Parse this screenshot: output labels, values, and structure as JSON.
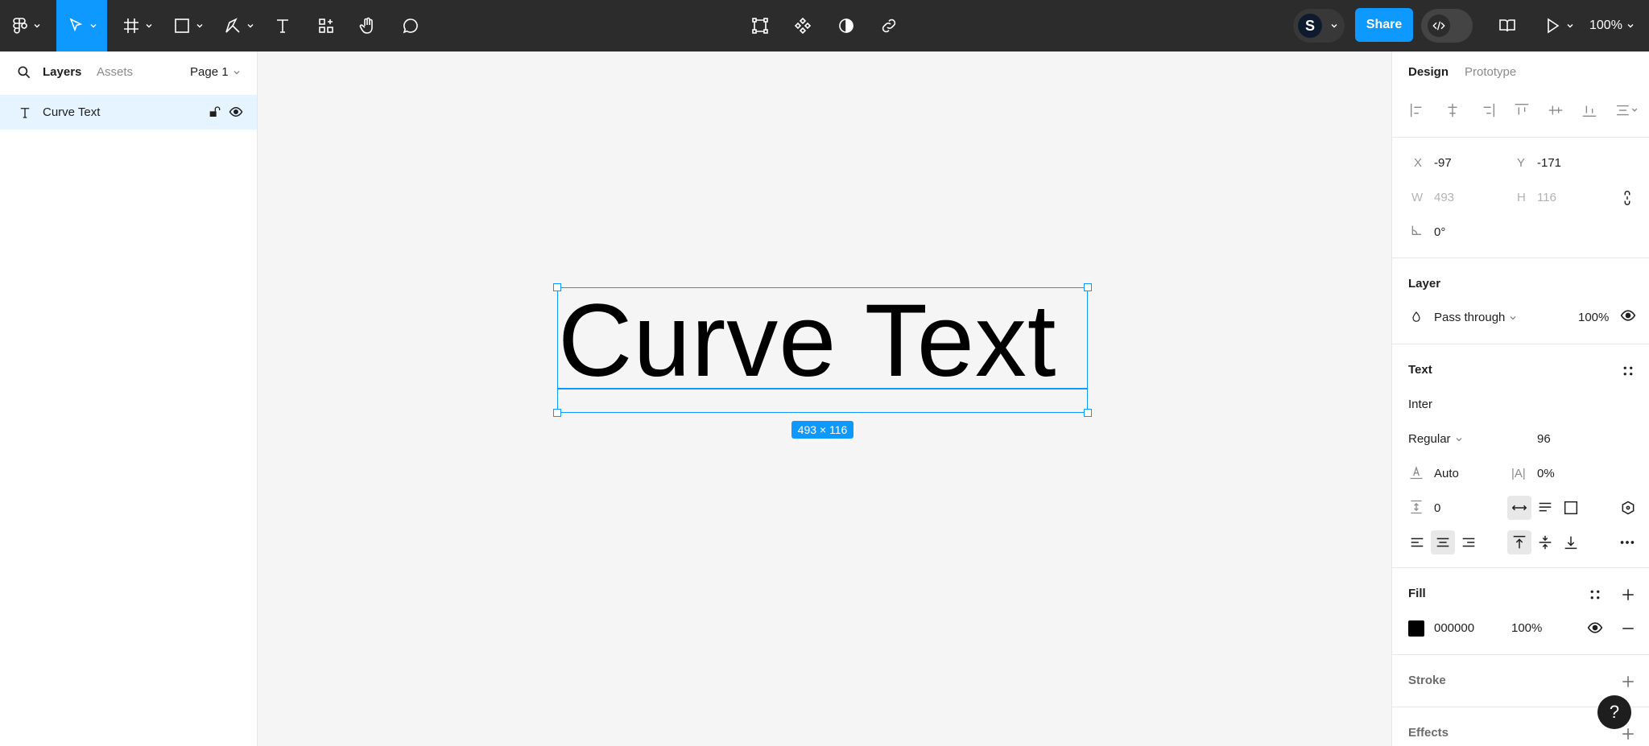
{
  "toolbar": {
    "share_label": "Share",
    "avatar_initial": "S",
    "zoom_label": "100%"
  },
  "left_panel": {
    "tabs": [
      "Layers",
      "Assets"
    ],
    "page_label": "Page 1",
    "layers": [
      {
        "name": "Curve Text",
        "type": "text"
      }
    ]
  },
  "canvas": {
    "text_content": "Curve Text",
    "dimension_badge": "493 × 116"
  },
  "right_panel": {
    "tabs": [
      "Design",
      "Prototype"
    ],
    "position": {
      "x_label": "X",
      "x_value": "-97",
      "y_label": "Y",
      "y_value": "-171",
      "w_label": "W",
      "w_value": "493",
      "h_label": "H",
      "h_value": "116",
      "rotation": "0°"
    },
    "layer": {
      "title": "Layer",
      "blend_mode": "Pass through",
      "opacity": "100%"
    },
    "text": {
      "title": "Text",
      "font_family": "Inter",
      "font_weight": "Regular",
      "font_size": "96",
      "line_height": "Auto",
      "letter_spacing": "0%",
      "paragraph_spacing": "0",
      "letter_spacing_icon": "|A|"
    },
    "fill": {
      "title": "Fill",
      "color_hex": "000000",
      "opacity": "100%",
      "swatch": "#000000"
    },
    "stroke": {
      "title": "Stroke"
    },
    "effects": {
      "title": "Effects"
    }
  },
  "colors": {
    "accent": "#0d99ff",
    "toolbar_bg": "#2c2c2c",
    "selected_row": "#e5f4ff"
  }
}
